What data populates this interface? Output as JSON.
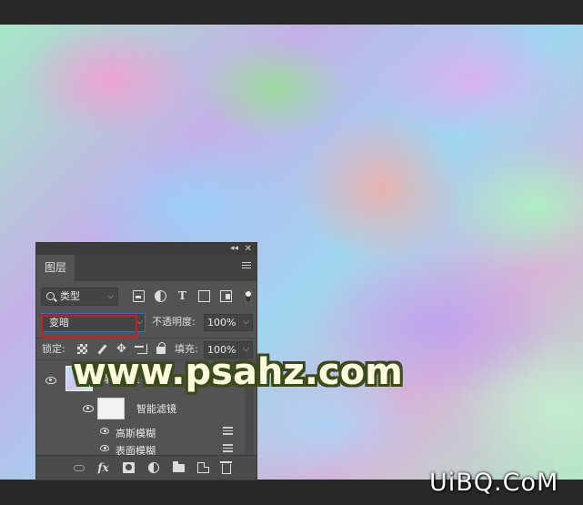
{
  "layers_panel": {
    "tab_label": "图层",
    "filter": {
      "kind_label": "类型"
    },
    "blend_mode": {
      "value": "变暗"
    },
    "opacity": {
      "label": "不透明度:",
      "value": "100%"
    },
    "lock": {
      "label": "锁定:"
    },
    "fill": {
      "label": "填充:",
      "value": "100%"
    },
    "layers": [
      {
        "name": "背景拷贝"
      }
    ],
    "smart_filters": {
      "label": "智能滤镜",
      "items": [
        {
          "name": "高斯模糊"
        },
        {
          "name": "表面模糊"
        }
      ]
    }
  },
  "watermarks": {
    "main": "www.psahz.com",
    "corner": "UiBQ.CoM"
  },
  "colors": {
    "panel_bg": "#535353",
    "highlight": "#e01515",
    "app_bg": "#282828"
  }
}
